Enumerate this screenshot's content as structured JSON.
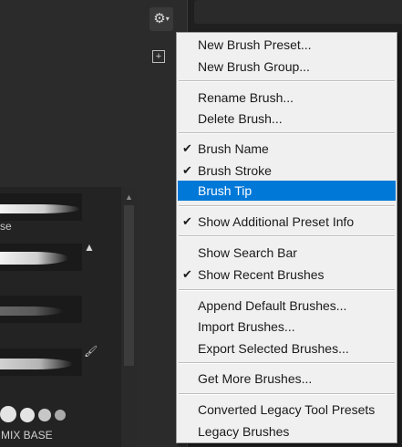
{
  "menu": {
    "new_brush_preset": "New Brush Preset...",
    "new_brush_group": "New Brush Group...",
    "rename_brush": "Rename Brush...",
    "delete_brush": "Delete Brush...",
    "brush_name": "Brush Name",
    "brush_stroke": "Brush Stroke",
    "brush_tip": "Brush Tip",
    "show_additional_preset_info": "Show Additional Preset Info",
    "show_search_bar": "Show Search Bar",
    "show_recent_brushes": "Show Recent Brushes",
    "append_default_brushes": "Append Default Brushes...",
    "import_brushes": "Import Brushes...",
    "export_selected_brushes": "Export Selected Brushes...",
    "get_more_brushes": "Get More Brushes...",
    "converted_legacy_tool_presets": "Converted Legacy Tool Presets",
    "legacy_brushes": "Legacy Brushes",
    "check_glyph": "✔",
    "checked": {
      "brush_name": true,
      "brush_stroke": true,
      "brush_tip": false,
      "show_additional_preset_info": true,
      "show_search_bar": false,
      "show_recent_brushes": true
    },
    "highlighted": "brush_tip"
  },
  "panel": {
    "row1_label": "se",
    "mix_base_label": "MIX BASE",
    "gear_glyph": "⚙",
    "caret_glyph": "▾",
    "new_group_glyph": "+"
  },
  "colors": {
    "menu_bg": "#f0f0f0",
    "highlight": "#0078d7",
    "panel_bg": "#2b2b2b"
  },
  "icons": [
    "gear-icon",
    "plus-square-icon",
    "check-icon",
    "triangle-icon",
    "brush-icon",
    "scroll-up-icon"
  ]
}
